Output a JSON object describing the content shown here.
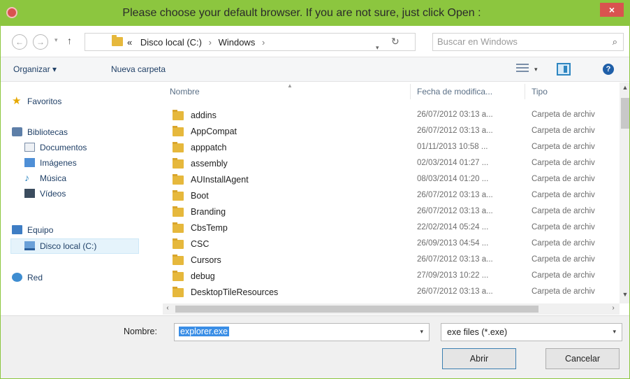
{
  "window": {
    "title": "Please choose your default browser. If you are not sure, just click Open :",
    "close_label": "×"
  },
  "address": {
    "crumbs": [
      "«",
      "Disco local (C:)",
      "Windows"
    ],
    "separator": "›",
    "search_placeholder": "Buscar en Windows"
  },
  "toolbar": {
    "organize_label": "Organizar ▾",
    "new_folder_label": "Nueva carpeta"
  },
  "sidebar": {
    "favorites": "Favoritos",
    "libraries": "Bibliotecas",
    "documents": "Documentos",
    "images": "Imágenes",
    "music": "Música",
    "videos": "Vídeos",
    "computer": "Equipo",
    "local_disk": "Disco local (C:)",
    "network": "Red"
  },
  "columns": {
    "name": "Nombre",
    "date": "Fecha de modifica...",
    "type": "Tipo"
  },
  "files": [
    {
      "name": "addins",
      "date": "26/07/2012 03:13 a...",
      "type": "Carpeta de archiv"
    },
    {
      "name": "AppCompat",
      "date": "26/07/2012 03:13 a...",
      "type": "Carpeta de archiv"
    },
    {
      "name": "apppatch",
      "date": "01/11/2013 10:58 ...",
      "type": "Carpeta de archiv"
    },
    {
      "name": "assembly",
      "date": "02/03/2014 01:27 ...",
      "type": "Carpeta de archiv"
    },
    {
      "name": "AUInstallAgent",
      "date": "08/03/2014 01:20 ...",
      "type": "Carpeta de archiv"
    },
    {
      "name": "Boot",
      "date": "26/07/2012 03:13 a...",
      "type": "Carpeta de archiv"
    },
    {
      "name": "Branding",
      "date": "26/07/2012 03:13 a...",
      "type": "Carpeta de archiv"
    },
    {
      "name": "CbsTemp",
      "date": "22/02/2014 05:24 ...",
      "type": "Carpeta de archiv"
    },
    {
      "name": "CSC",
      "date": "26/09/2013 04:54 ...",
      "type": "Carpeta de archiv"
    },
    {
      "name": "Cursors",
      "date": "26/07/2012 03:13 a...",
      "type": "Carpeta de archiv"
    },
    {
      "name": "debug",
      "date": "27/09/2013 10:22 ...",
      "type": "Carpeta de archiv"
    },
    {
      "name": "DesktopTileResources",
      "date": "26/07/2012 03:13 a...",
      "type": "Carpeta de archiv"
    }
  ],
  "footer": {
    "filename_label": "Nombre:",
    "filename_value": "explorer.exe",
    "filetype_value": "exe files (*.exe)",
    "open_label": "Abrir",
    "cancel_label": "Cancelar"
  },
  "colors": {
    "title_bar": "#8cc63f",
    "close_button": "#d9534f",
    "selection": "#3a8ee6",
    "folder": "#e6b83c"
  }
}
